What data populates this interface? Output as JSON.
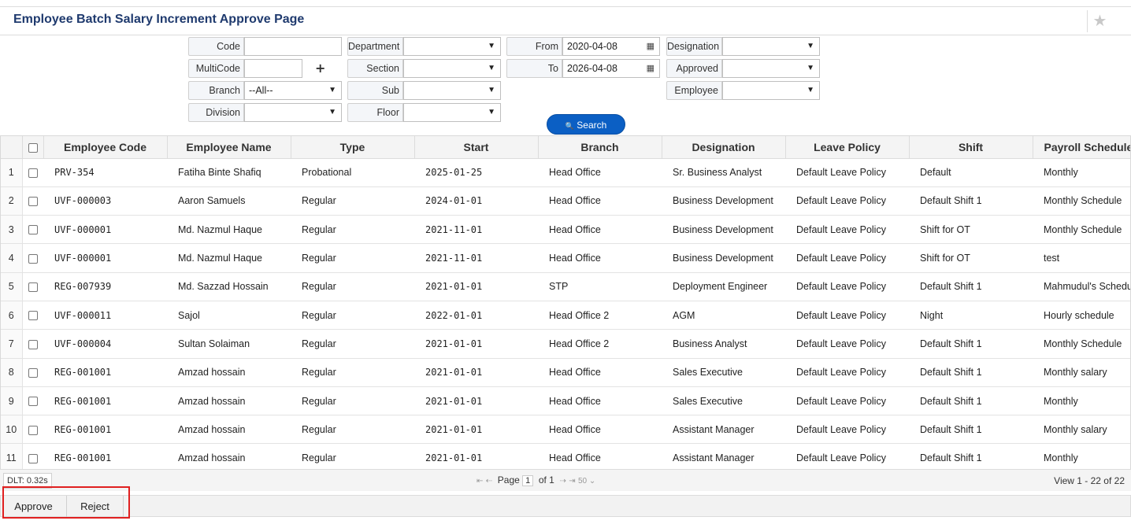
{
  "page": {
    "title": "Employee Batch Salary Increment Approve Page",
    "star_icon": "star-icon"
  },
  "filters": {
    "code": {
      "label": "Code",
      "value": ""
    },
    "multicode": {
      "label": "MultiCode",
      "value": ""
    },
    "branch": {
      "label": "Branch",
      "value": "--All--"
    },
    "division": {
      "label": "Division",
      "value": ""
    },
    "department": {
      "label": "Department",
      "value": ""
    },
    "section": {
      "label": "Section",
      "value": ""
    },
    "sub": {
      "label": "Sub",
      "value": ""
    },
    "floor": {
      "label": "Floor",
      "value": ""
    },
    "from": {
      "label": "From",
      "value": "2020-04-08"
    },
    "to": {
      "label": "To",
      "value": "2026-04-08"
    },
    "designation": {
      "label": "Designation",
      "value": ""
    },
    "approved": {
      "label": "Approved",
      "value": ""
    },
    "employee": {
      "label": "Employee",
      "value": ""
    },
    "plus": "+",
    "search_label": "Search",
    "search_icon": "🔍"
  },
  "grid": {
    "columns": [
      "Employee Code",
      "Employee Name",
      "Type",
      "Start",
      "Branch",
      "Designation",
      "Leave Policy",
      "Shift",
      "Payroll Schedule"
    ],
    "rows": [
      {
        "n": "1",
        "code": "PRV-354",
        "name": "Fatiha Binte Shafiq",
        "type": "Probational",
        "start": "2025-01-25",
        "branch": "Head Office",
        "designation": "Sr. Business Analyst",
        "leave": "Default Leave Policy",
        "shift": "Default",
        "payroll": "Monthly"
      },
      {
        "n": "2",
        "code": "UVF-000003",
        "name": "Aaron Samuels",
        "type": "Regular",
        "start": "2024-01-01",
        "branch": "Head Office",
        "designation": "Business Development",
        "leave": "Default Leave Policy",
        "shift": "Default Shift 1",
        "payroll": "Monthly Schedule"
      },
      {
        "n": "3",
        "code": "UVF-000001",
        "name": "Md. Nazmul Haque",
        "type": "Regular",
        "start": "2021-11-01",
        "branch": "Head Office",
        "designation": "Business Development",
        "leave": "Default Leave Policy",
        "shift": "Shift for OT",
        "payroll": "Monthly Schedule"
      },
      {
        "n": "4",
        "code": "UVF-000001",
        "name": "Md. Nazmul Haque",
        "type": "Regular",
        "start": "2021-11-01",
        "branch": "Head Office",
        "designation": "Business Development",
        "leave": "Default Leave Policy",
        "shift": "Shift for OT",
        "payroll": "test"
      },
      {
        "n": "5",
        "code": "REG-007939",
        "name": "Md. Sazzad Hossain",
        "type": "Regular",
        "start": "2021-01-01",
        "branch": "STP",
        "designation": "Deployment Engineer",
        "leave": "Default Leave Policy",
        "shift": "Default Shift 1",
        "payroll": "Mahmudul's Schedule"
      },
      {
        "n": "6",
        "code": "UVF-000011",
        "name": "Sajol",
        "type": "Regular",
        "start": "2022-01-01",
        "branch": "Head Office 2",
        "designation": "AGM",
        "leave": "Default Leave Policy",
        "shift": "Night",
        "payroll": "Hourly schedule"
      },
      {
        "n": "7",
        "code": "UVF-000004",
        "name": "Sultan Solaiman",
        "type": "Regular",
        "start": "2021-01-01",
        "branch": "Head Office 2",
        "designation": "Business Analyst",
        "leave": "Default Leave Policy",
        "shift": "Default Shift 1",
        "payroll": "Monthly Schedule"
      },
      {
        "n": "8",
        "code": "REG-001001",
        "name": "Amzad hossain",
        "type": "Regular",
        "start": "2021-01-01",
        "branch": "Head Office",
        "designation": "Sales Executive",
        "leave": "Default Leave Policy",
        "shift": "Default Shift 1",
        "payroll": "Monthly salary"
      },
      {
        "n": "9",
        "code": "REG-001001",
        "name": "Amzad hossain",
        "type": "Regular",
        "start": "2021-01-01",
        "branch": "Head Office",
        "designation": "Sales Executive",
        "leave": "Default Leave Policy",
        "shift": "Default Shift 1",
        "payroll": "Monthly"
      },
      {
        "n": "10",
        "code": "REG-001001",
        "name": "Amzad hossain",
        "type": "Regular",
        "start": "2021-01-01",
        "branch": "Head Office",
        "designation": "Assistant Manager",
        "leave": "Default Leave Policy",
        "shift": "Default Shift 1",
        "payroll": "Monthly salary"
      },
      {
        "n": "11",
        "code": "REG-001001",
        "name": "Amzad hossain",
        "type": "Regular",
        "start": "2021-01-01",
        "branch": "Head Office",
        "designation": "Assistant Manager",
        "leave": "Default Leave Policy",
        "shift": "Default Shift 1",
        "payroll": "Monthly"
      }
    ]
  },
  "pager": {
    "dlt": "DLT: 0.32s",
    "first": "⇤",
    "prev": "⇠",
    "page_label": "Page",
    "page": "1",
    "of": "of 1",
    "next": "⇢",
    "last": "⇥",
    "rows": "50",
    "view": "View 1 - 22 of 22"
  },
  "actions": {
    "approve": "Approve",
    "reject": "Reject"
  },
  "colors": {
    "accent": "#0b5fc4",
    "title": "#1f3a6e",
    "highlight": "#e02020"
  }
}
